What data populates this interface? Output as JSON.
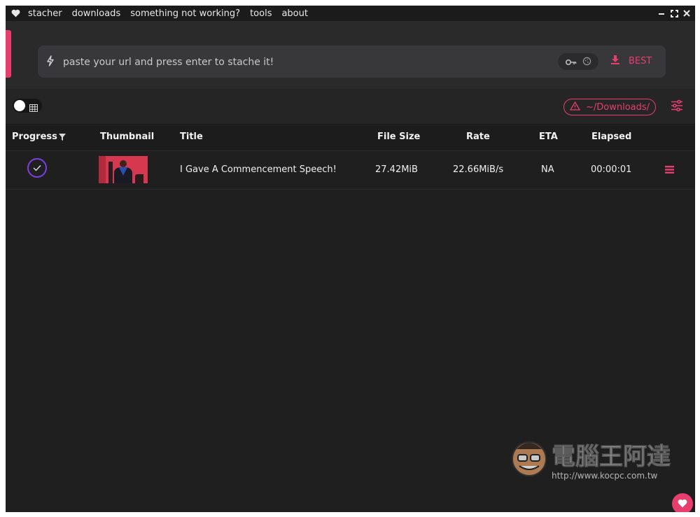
{
  "menu": {
    "app_name": "stacher",
    "items": [
      "downloads",
      "something not working?",
      "tools",
      "about"
    ]
  },
  "url_bar": {
    "placeholder": "paste your url and press enter to stache it!",
    "quality_label": "BEST"
  },
  "toolbar": {
    "download_path": "~/Downloads/"
  },
  "table": {
    "headers": [
      "Progress",
      "Thumbnail",
      "Title",
      "File Size",
      "Rate",
      "ETA",
      "Elapsed"
    ],
    "rows": [
      {
        "title": "I Gave A Commencement Speech!",
        "file_size": "27.42MiB",
        "rate": "22.66MiB/s",
        "eta": "NA",
        "elapsed": "00:00:01",
        "status": "complete"
      }
    ]
  },
  "watermark": {
    "cjk_text": "電腦王阿達",
    "url": "http://www.kocpc.com.tw"
  },
  "colors": {
    "accent": "#e83e6d",
    "progress_ring": "#7b3fe4",
    "background": "#1f1f20"
  }
}
